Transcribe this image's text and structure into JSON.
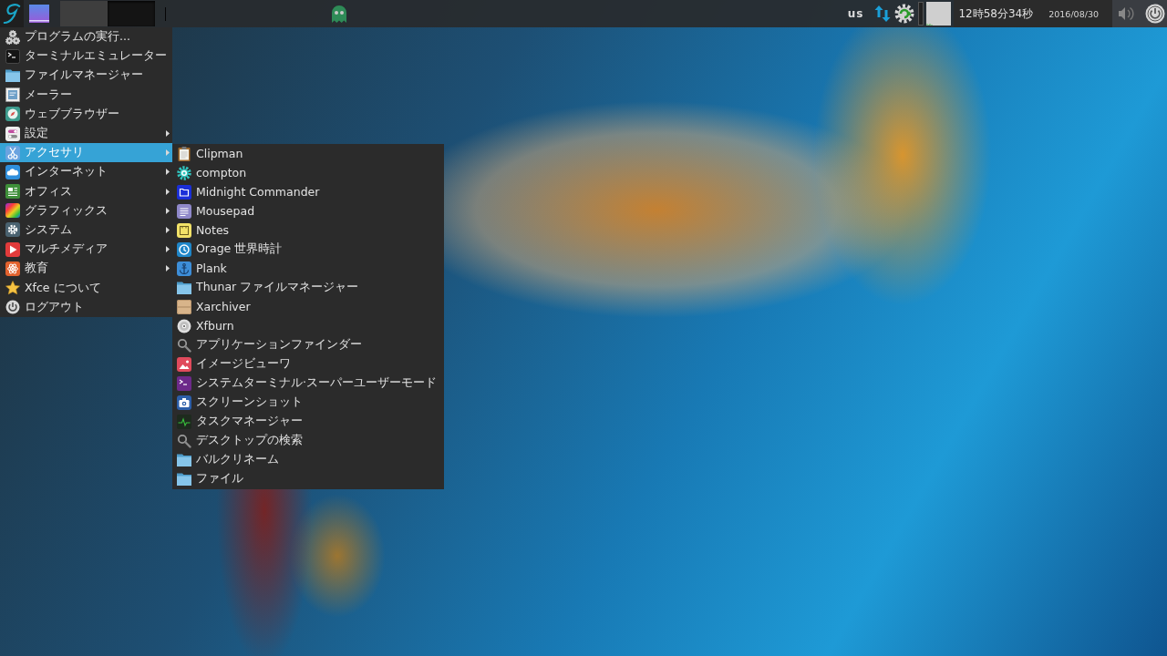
{
  "panel": {
    "window_buttons": [
      {
        "selected": false
      },
      {
        "selected": true
      }
    ],
    "keyboard_layout": "us",
    "clock": {
      "time": "12時58分34秒",
      "date": "2016/08/30"
    }
  },
  "menu": {
    "items": [
      {
        "label": "プログラムの実行...",
        "has_submenu": false,
        "selected": false
      },
      {
        "label": "ターミナルエミュレーター",
        "has_submenu": false,
        "selected": false
      },
      {
        "label": "ファイルマネージャー",
        "has_submenu": false,
        "selected": false
      },
      {
        "label": "メーラー",
        "has_submenu": false,
        "selected": false
      },
      {
        "label": "ウェブブラウザー",
        "has_submenu": false,
        "selected": false
      },
      {
        "label": "設定",
        "has_submenu": true,
        "selected": false
      },
      {
        "label": "アクセサリ",
        "has_submenu": true,
        "selected": true
      },
      {
        "label": "インターネット",
        "has_submenu": true,
        "selected": false
      },
      {
        "label": "オフィス",
        "has_submenu": true,
        "selected": false
      },
      {
        "label": "グラフィックス",
        "has_submenu": true,
        "selected": false
      },
      {
        "label": "システム",
        "has_submenu": true,
        "selected": false
      },
      {
        "label": "マルチメディア",
        "has_submenu": true,
        "selected": false
      },
      {
        "label": "教育",
        "has_submenu": true,
        "selected": false
      },
      {
        "label": "Xfce について",
        "has_submenu": false,
        "selected": false
      },
      {
        "label": "ログアウト",
        "has_submenu": false,
        "selected": false
      }
    ]
  },
  "submenu": {
    "items": [
      {
        "label": "Clipman",
        "selected": false
      },
      {
        "label": "compton",
        "selected": false
      },
      {
        "label": "Midnight Commander",
        "selected": false
      },
      {
        "label": "Mousepad",
        "selected": false
      },
      {
        "label": "Notes",
        "selected": false
      },
      {
        "label": "Orage 世界時計",
        "selected": false
      },
      {
        "label": "Plank",
        "selected": false
      },
      {
        "label": "Thunar ファイルマネージャー",
        "selected": false
      },
      {
        "label": "Xarchiver",
        "selected": false
      },
      {
        "label": "Xfburn",
        "selected": false
      },
      {
        "label": "アプリケーションファインダー",
        "selected": false
      },
      {
        "label": "イメージビューワ",
        "selected": false
      },
      {
        "label": "システムターミナル·スーパーユーザーモード",
        "selected": false
      },
      {
        "label": "スクリーンショット",
        "selected": false
      },
      {
        "label": "タスクマネージャー",
        "selected": false
      },
      {
        "label": "デスクトップの検索",
        "selected": false
      },
      {
        "label": "バルクリネーム",
        "selected": false
      },
      {
        "label": "ファイル",
        "selected": false
      }
    ]
  }
}
